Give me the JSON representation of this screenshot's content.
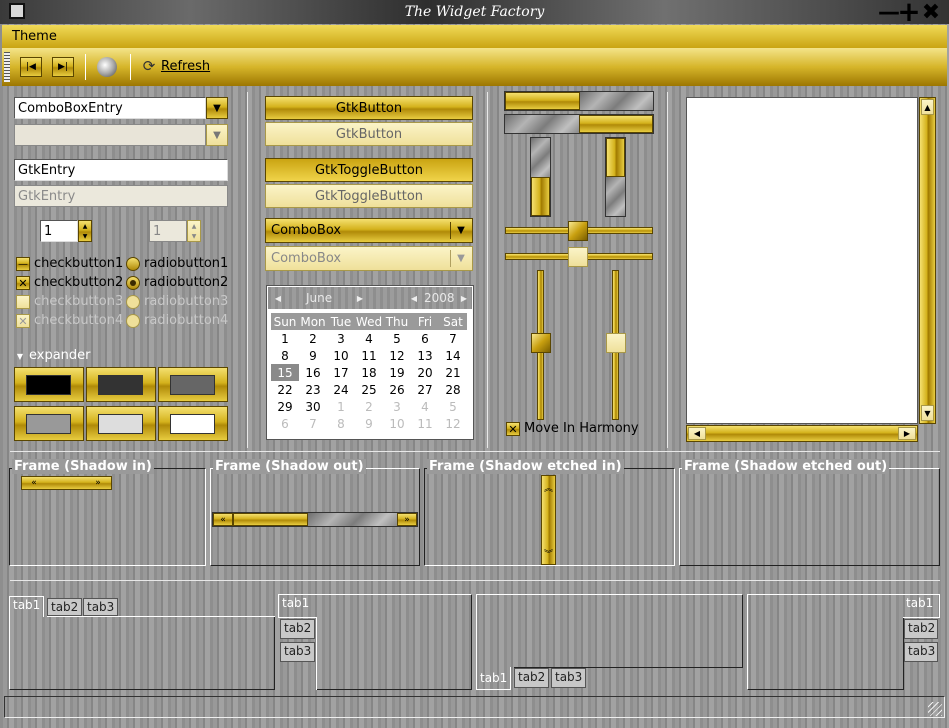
{
  "window": {
    "title": "The Widget Factory"
  },
  "menubar": {
    "theme": "Theme"
  },
  "toolbar": {
    "refresh": "Refresh"
  },
  "combo_entry": {
    "value": "ComboBoxEntry"
  },
  "entries": {
    "entry": "GtkEntry",
    "entry_disabled": "GtkEntry"
  },
  "spin": {
    "a": "1",
    "b": "1"
  },
  "checks": [
    "checkbutton1",
    "checkbutton2",
    "checkbutton3",
    "checkbutton4"
  ],
  "radios": [
    "radiobutton1",
    "radiobutton2",
    "radiobutton3",
    "radiobutton4"
  ],
  "expander": {
    "label": "expander"
  },
  "swatches": [
    "#000000",
    "#333333",
    "#666666",
    "#999999",
    "#dddddd",
    "#ffffff"
  ],
  "buttons": {
    "b1": "GtkButton",
    "b2": "GtkButton",
    "t1": "GtkToggleButton",
    "t2": "GtkToggleButton",
    "combo": "ComboBox",
    "combo_disabled": "ComboBox"
  },
  "calendar": {
    "month": "June",
    "year": "2008",
    "days": [
      "Sun",
      "Mon",
      "Tue",
      "Wed",
      "Thu",
      "Fri",
      "Sat"
    ],
    "weeks": [
      [
        "1",
        "2",
        "3",
        "4",
        "5",
        "6",
        "7"
      ],
      [
        "8",
        "9",
        "10",
        "11",
        "12",
        "13",
        "14"
      ],
      [
        "15",
        "16",
        "17",
        "18",
        "19",
        "20",
        "21"
      ],
      [
        "22",
        "23",
        "24",
        "25",
        "26",
        "27",
        "28"
      ],
      [
        "29",
        "30",
        "1",
        "2",
        "3",
        "4",
        "5"
      ],
      [
        "6",
        "7",
        "8",
        "9",
        "10",
        "11",
        "12"
      ]
    ],
    "selected": "15"
  },
  "harmony": {
    "label": "Move In Harmony"
  },
  "frames": [
    "Frame (Shadow in)",
    "Frame (Shadow out)",
    "Frame (Shadow etched in)",
    "Frame (Shadow etched out)"
  ],
  "tabs": [
    "tab1",
    "tab2",
    "tab3"
  ]
}
